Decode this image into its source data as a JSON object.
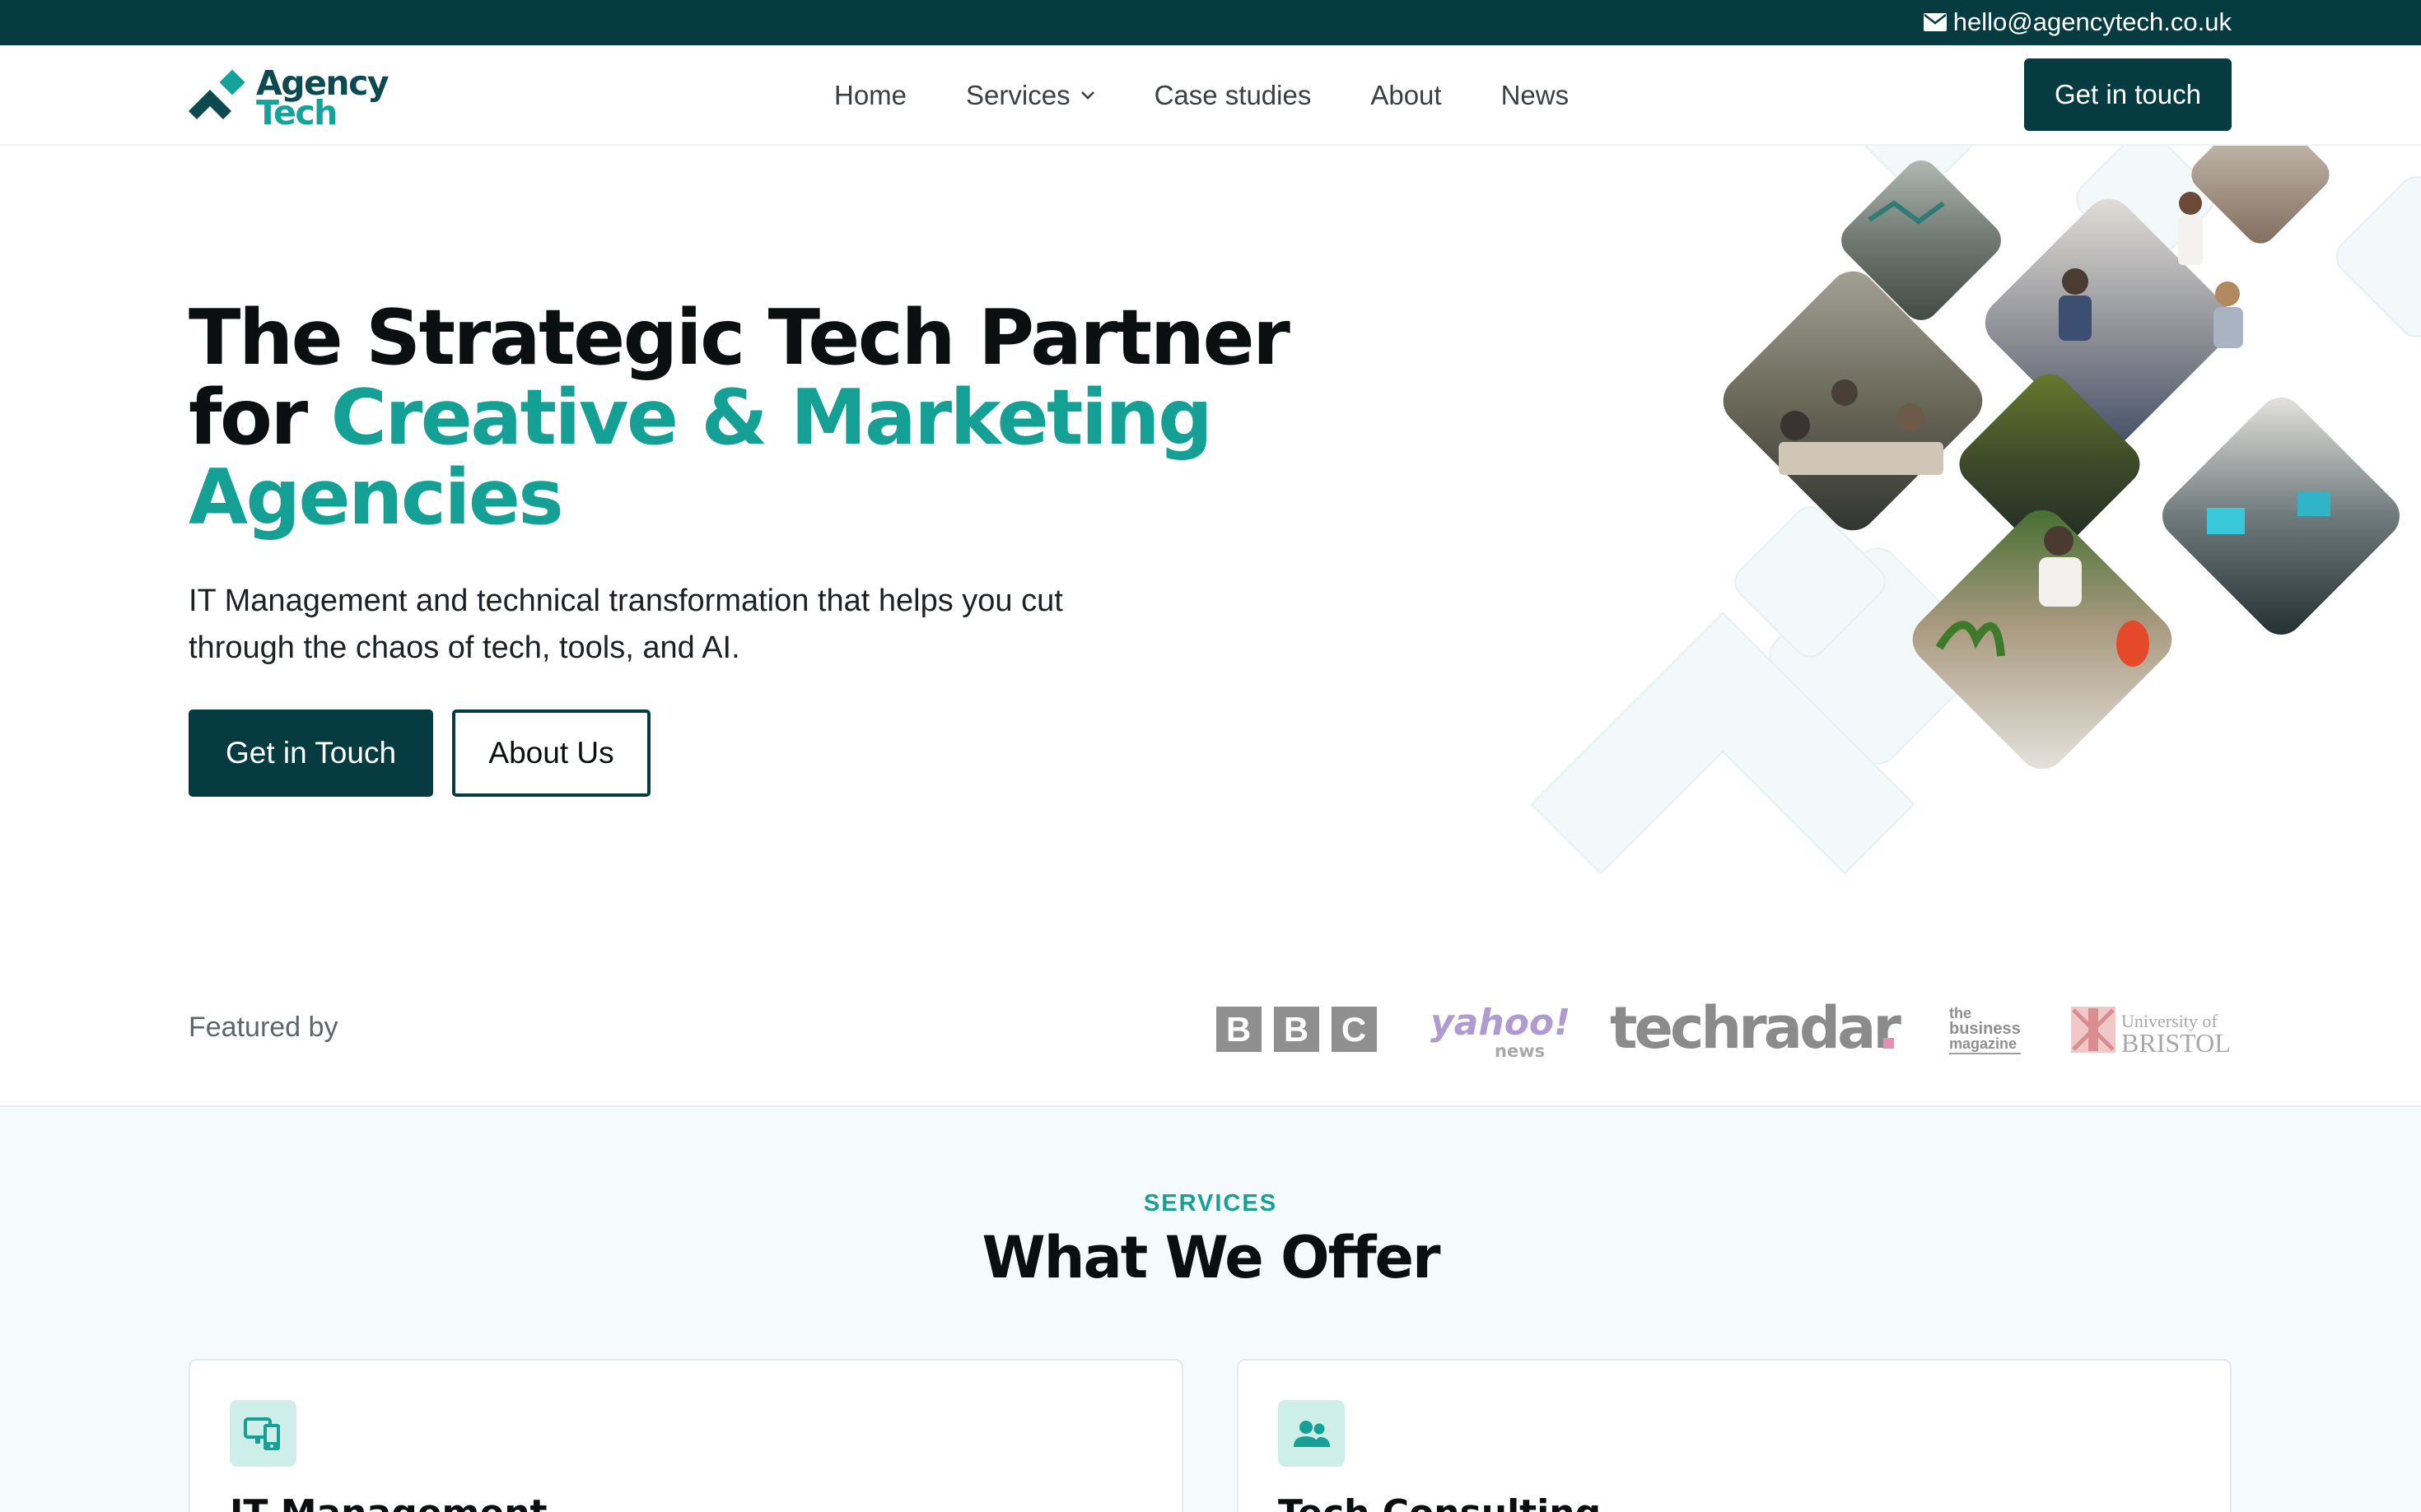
{
  "topbar": {
    "email": "hello@agencytech.co.uk",
    "icon": "envelope-icon"
  },
  "header": {
    "logo": {
      "line1": "Agency",
      "line2": "Tech",
      "colors": {
        "dark": "#0d4a50",
        "accent": "#14a39a"
      }
    },
    "nav": [
      {
        "label": "Home",
        "has_dropdown": false
      },
      {
        "label": "Services",
        "has_dropdown": true
      },
      {
        "label": "Case studies",
        "has_dropdown": false
      },
      {
        "label": "About",
        "has_dropdown": false
      },
      {
        "label": "News",
        "has_dropdown": false
      }
    ],
    "cta_label": "Get in touch"
  },
  "hero": {
    "title_line1": "The Strategic Tech Partner",
    "title_for": "for ",
    "title_accent": "Creative & Marketing Agencies",
    "subtitle": "IT Management and technical transformation that helps you cut through the chaos of tech, tools, and AI.",
    "primary_button": "Get in Touch",
    "secondary_button": "About Us"
  },
  "featured": {
    "label": "Featured by",
    "logos": [
      {
        "name": "bbc-logo",
        "text": "BBC"
      },
      {
        "name": "yahoo-news-logo",
        "text": "yahoo!",
        "subtext": "news"
      },
      {
        "name": "techradar-logo",
        "text": "techradar."
      },
      {
        "name": "business-magazine-logo",
        "text": "the business magazine"
      },
      {
        "name": "university-of-bristol-logo",
        "text": "University of BRISTOL"
      }
    ]
  },
  "services": {
    "eyebrow": "SERVICES",
    "title": "What We Offer",
    "cards": [
      {
        "title": "IT Management",
        "icon": "devices-icon"
      },
      {
        "title": "Tech Consulting",
        "icon": "people-icon"
      }
    ]
  },
  "colors": {
    "brand_dark": "#073b42",
    "brand_accent": "#15a096",
    "section_bg": "#f5fafc"
  }
}
